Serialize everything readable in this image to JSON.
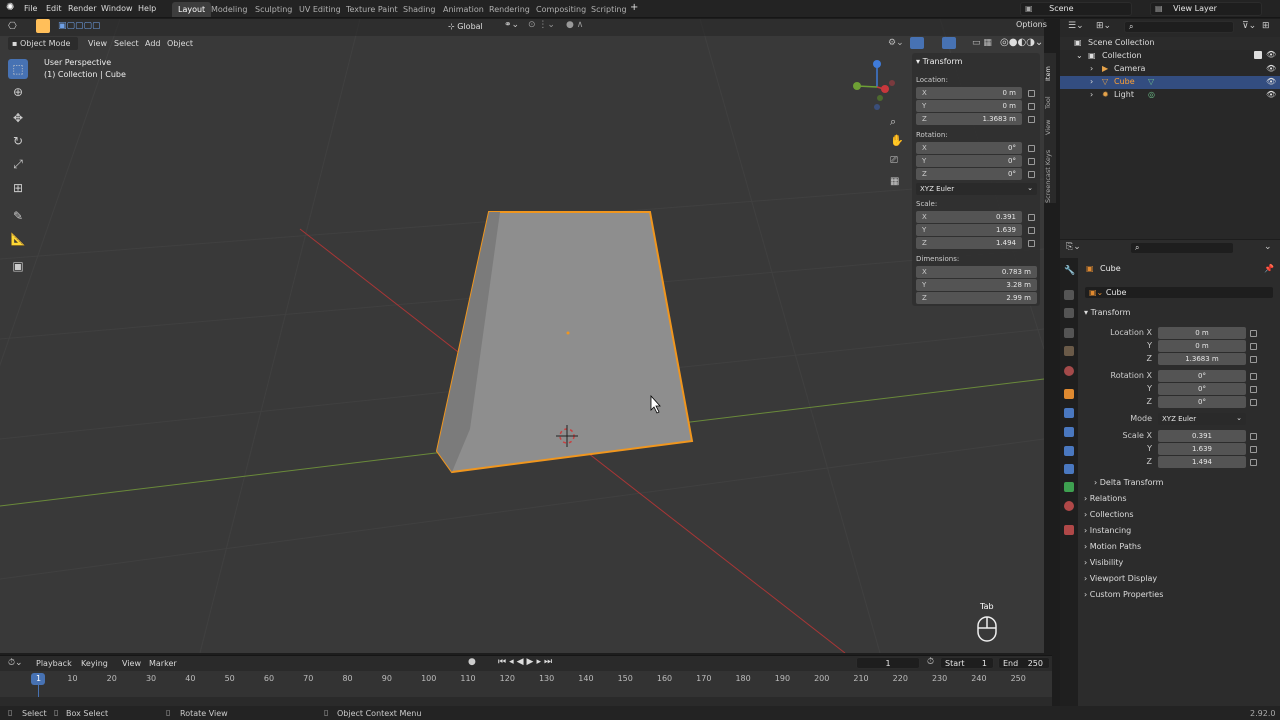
{
  "topbar": {
    "menus": [
      "File",
      "Edit",
      "Render",
      "Window",
      "Help"
    ],
    "workspaces": [
      "Layout",
      "Modeling",
      "Sculpting",
      "UV Editing",
      "Texture Paint",
      "Shading",
      "Animation",
      "Rendering",
      "Compositing",
      "Scripting"
    ],
    "active_workspace": "Layout",
    "add_tab": "+",
    "scene": "Scene",
    "view_layer": "View Layer"
  },
  "viewport_header": {
    "mode": "Object Mode",
    "menus": [
      "View",
      "Select",
      "Add",
      "Object"
    ],
    "orientation": "Global",
    "options": "Options"
  },
  "viewport": {
    "perspective": "User Perspective",
    "collection_info": "(1) Collection | Cube",
    "tab_hint": "Tab",
    "gizmo": {
      "x": "X",
      "y": "Y",
      "z": "Z"
    }
  },
  "npanel": {
    "title": "Transform",
    "location_label": "Location:",
    "location": [
      {
        "axis": "X",
        "value": "0 m"
      },
      {
        "axis": "Y",
        "value": "0 m"
      },
      {
        "axis": "Z",
        "value": "1.3683 m"
      }
    ],
    "rotation_label": "Rotation:",
    "rotation": [
      {
        "axis": "X",
        "value": "0°"
      },
      {
        "axis": "Y",
        "value": "0°"
      },
      {
        "axis": "Z",
        "value": "0°"
      }
    ],
    "rotation_mode": "XYZ Euler",
    "scale_label": "Scale:",
    "scale": [
      {
        "axis": "X",
        "value": "0.391"
      },
      {
        "axis": "Y",
        "value": "1.639"
      },
      {
        "axis": "Z",
        "value": "1.494"
      }
    ],
    "dimensions_label": "Dimensions:",
    "dimensions": [
      {
        "axis": "X",
        "value": "0.783 m"
      },
      {
        "axis": "Y",
        "value": "3.28 m"
      },
      {
        "axis": "Z",
        "value": "2.99 m"
      }
    ],
    "tabs": [
      "Item",
      "Tool",
      "View",
      "Screencast Keys"
    ]
  },
  "outliner": {
    "root": "Scene Collection",
    "collection": "Collection",
    "items": [
      "Camera",
      "Cube",
      "Light"
    ],
    "selected": "Cube"
  },
  "properties": {
    "object_name": "Cube",
    "data_name": "Cube",
    "transform_title": "Transform",
    "location_label": "Location X",
    "location": [
      "0 m",
      "0 m",
      "1.3683 m"
    ],
    "rotation_label": "Rotation X",
    "rotation": [
      "0°",
      "0°",
      "0°"
    ],
    "axis_y": "Y",
    "axis_z": "Z",
    "mode_label": "Mode",
    "mode_value": "XYZ Euler",
    "scale_label": "Scale X",
    "scale": [
      "0.391",
      "1.639",
      "1.494"
    ],
    "sections": [
      "Delta Transform",
      "Relations",
      "Collections",
      "Instancing",
      "Motion Paths",
      "Visibility",
      "Viewport Display",
      "Custom Properties"
    ]
  },
  "timeline": {
    "menus": [
      "Playback",
      "Keying",
      "View",
      "Marker"
    ],
    "current_frame": "1",
    "start_label": "Start",
    "start": "1",
    "end_label": "End",
    "end": "250",
    "ticks": [
      "1",
      "10",
      "20",
      "30",
      "40",
      "50",
      "60",
      "70",
      "80",
      "90",
      "100",
      "110",
      "120",
      "130",
      "140",
      "150",
      "160",
      "170",
      "180",
      "190",
      "200",
      "210",
      "220",
      "230",
      "240",
      "250"
    ]
  },
  "statusbar": {
    "select": "Select",
    "box_select": "Box Select",
    "rotate_view": "Rotate View",
    "context_menu": "Object Context Menu",
    "version": "2.92.0"
  },
  "colors": {
    "accent": "#4772b3",
    "selection": "#ffa033",
    "x_axis": "#c8373c",
    "y_axis": "#6ea035",
    "z_axis": "#3f7bd9"
  }
}
